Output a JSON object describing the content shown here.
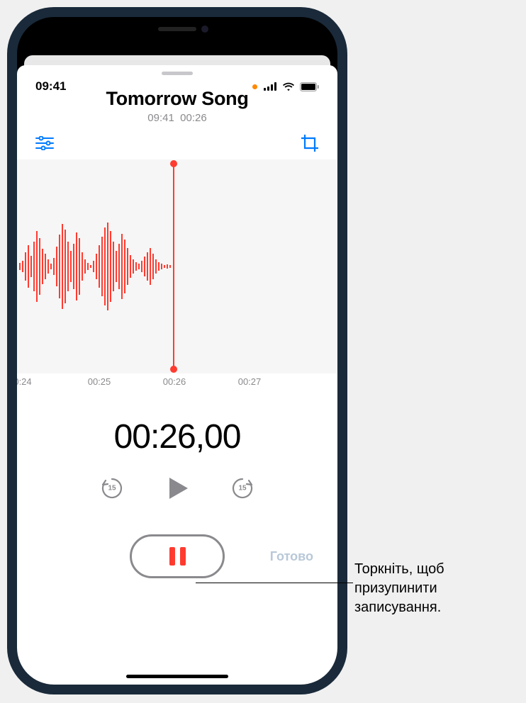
{
  "status": {
    "time": "09:41"
  },
  "recording": {
    "title": "Tomorrow Song",
    "clock": "09:41",
    "duration": "00:26"
  },
  "timeline": {
    "ticks": [
      "0:24",
      "00:25",
      "00:26",
      "00:27"
    ]
  },
  "timer": "00:26,00",
  "skip": {
    "back": "15",
    "forward": "15"
  },
  "done_label": "Готово",
  "callout": "Торкніть, щоб призупинити записування."
}
